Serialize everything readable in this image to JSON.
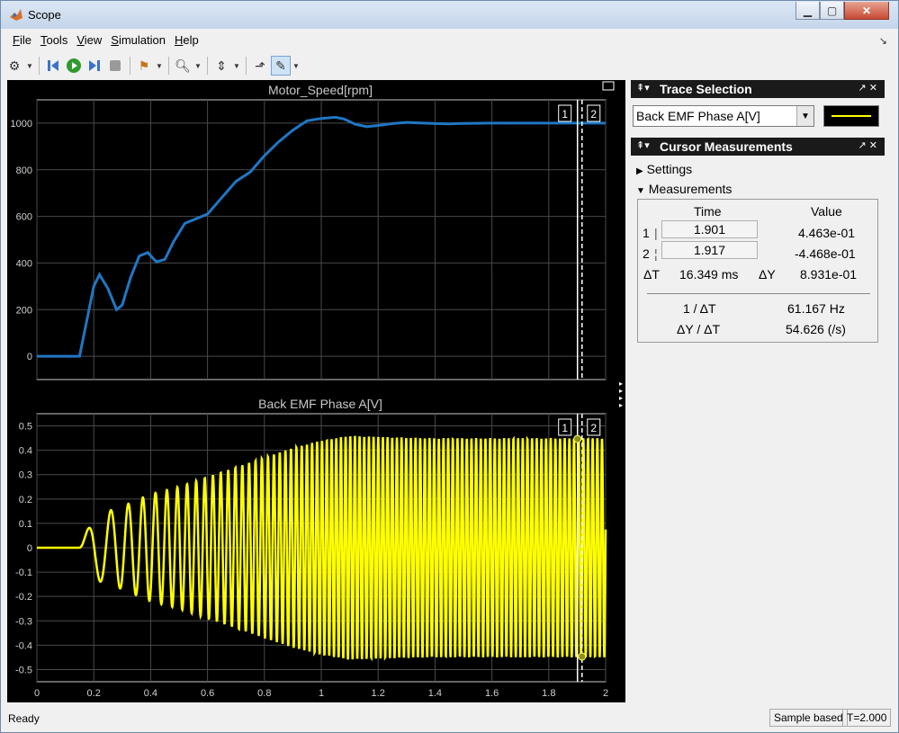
{
  "window": {
    "title": "Scope"
  },
  "menu": [
    "File",
    "Tools",
    "View",
    "Simulation",
    "Help"
  ],
  "toolbar": {
    "icons": [
      "settings-icon",
      "dropdown-icon",
      "step-back-icon",
      "run-icon",
      "step-forward-icon",
      "stop-icon",
      "highlight-icon",
      "dropdown-icon",
      "zoom-icon",
      "dropdown-icon",
      "scale-axes-icon",
      "dropdown-icon",
      "triggers-icon",
      "cursor-measurements-icon",
      "dropdown-icon"
    ]
  },
  "plots": {
    "top_title": "Motor_Speed[rpm]",
    "bottom_title": "Back EMF Phase A[V]",
    "cursor1_label": "1",
    "cursor2_label": "2"
  },
  "trace_selection": {
    "header": "Trace Selection",
    "selected": "Back EMF Phase A[V]",
    "line_color": "#ffff00"
  },
  "cursor_measurements": {
    "header": "Cursor Measurements",
    "settings_label": "Settings",
    "measurements_label": "Measurements",
    "col_time": "Time",
    "col_value": "Value",
    "c1_label": "1",
    "c1_time": "1.901",
    "c1_value": "4.463e-01",
    "c2_label": "2",
    "c2_time": "1.917",
    "c2_value": "-4.468e-01",
    "dt_label": "ΔT",
    "dt_value": "16.349 ms",
    "dy_label": "ΔY",
    "dy_value": "8.931e-01",
    "inv_dt_label": "1 / ΔT",
    "inv_dt_value": "61.167 Hz",
    "dydt_label": "ΔY / ΔT",
    "dydt_value": "54.626 (/s)"
  },
  "status": {
    "left": "Ready",
    "mode": "Sample based",
    "time": "T=2.000"
  },
  "chart_data": [
    {
      "type": "line",
      "title": "Motor_Speed[rpm]",
      "xlim": [
        0,
        2
      ],
      "ylim": [
        -100,
        1100
      ],
      "xticks": [
        0,
        0.2,
        0.4,
        0.6,
        0.8,
        1,
        1.2,
        1.4,
        1.6,
        1.8,
        2
      ],
      "yticks": [
        0,
        200,
        400,
        600,
        800,
        1000
      ],
      "grid": true,
      "color": "#1f77c4",
      "x": [
        0,
        0.15,
        0.17,
        0.2,
        0.22,
        0.25,
        0.28,
        0.3,
        0.33,
        0.36,
        0.39,
        0.42,
        0.45,
        0.48,
        0.52,
        0.56,
        0.6,
        0.65,
        0.7,
        0.75,
        0.8,
        0.85,
        0.9,
        0.95,
        1.0,
        1.05,
        1.08,
        1.12,
        1.16,
        1.2,
        1.25,
        1.3,
        1.35,
        1.4,
        1.45,
        1.5,
        1.6,
        1.7,
        1.8,
        1.9,
        2.0
      ],
      "y": [
        0,
        0,
        120,
        300,
        350,
        290,
        200,
        220,
        340,
        430,
        445,
        405,
        415,
        490,
        570,
        590,
        610,
        680,
        750,
        790,
        860,
        920,
        970,
        1010,
        1020,
        1025,
        1018,
        995,
        985,
        990,
        998,
        1003,
        1001,
        998,
        997,
        999,
        1000,
        1000,
        1000,
        1000,
        1000
      ]
    },
    {
      "type": "line",
      "title": "Back EMF Phase A[V]",
      "xlim": [
        0,
        2
      ],
      "ylim": [
        -0.55,
        0.55
      ],
      "xticks": [
        0,
        0.2,
        0.4,
        0.6,
        0.8,
        1,
        1.2,
        1.4,
        1.6,
        1.8,
        2
      ],
      "yticks": [
        0.5,
        0.4,
        0.3,
        0.2,
        0.1,
        0,
        -0.1,
        -0.2,
        -0.3,
        -0.4,
        -0.5
      ],
      "grid": true,
      "color": "#ffff00",
      "description_points": {
        "x": [
          0,
          0.15,
          0.2,
          0.3,
          0.4,
          0.5,
          0.6,
          0.7,
          0.8,
          0.9,
          1.0,
          1.1,
          1.2,
          1.4,
          1.6,
          1.8,
          2.0
        ],
        "amplitude": [
          0,
          0,
          0.13,
          0.17,
          0.22,
          0.25,
          0.29,
          0.33,
          0.37,
          0.41,
          0.44,
          0.46,
          0.455,
          0.45,
          0.45,
          0.45,
          0.45
        ]
      },
      "cursor_points": [
        [
          1.901,
          0.4463
        ],
        [
          1.917,
          -0.4468
        ]
      ]
    }
  ]
}
